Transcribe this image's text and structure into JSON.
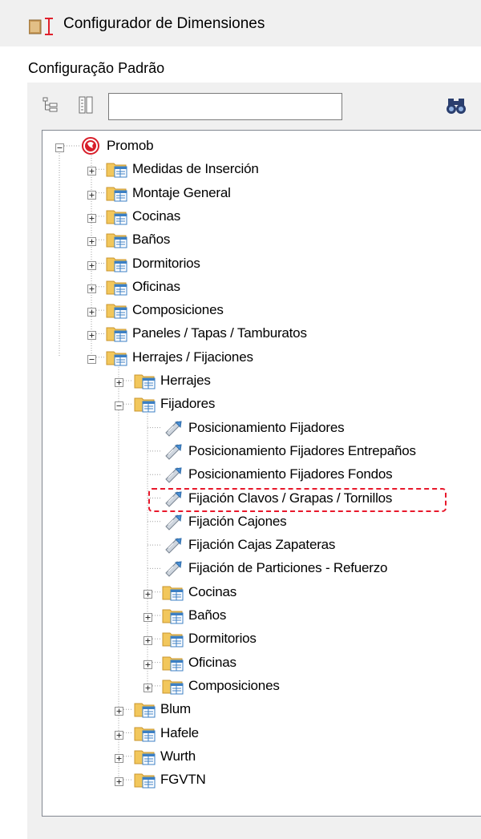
{
  "window": {
    "title": "Configurador de Dimensiones"
  },
  "config": {
    "label": "Configuração Padrão"
  },
  "toolbar": {
    "search_value": "",
    "search_placeholder": ""
  },
  "colors": {
    "highlight": "#e8182b",
    "folder": "#f2c75c",
    "tree_line": "#a0a0a0"
  },
  "tree": {
    "root": "Promob",
    "level1": [
      "Medidas de Inserción",
      "Montaje General",
      "Cocinas",
      "Baños",
      "Dormitorios",
      "Oficinas",
      "Composiciones",
      "Paneles / Tapas / Tamburatos",
      "Herrajes / Fijaciones"
    ],
    "herrajes_children": [
      "Herrajes",
      "Fijadores"
    ],
    "fijadores_items": [
      "Posicionamiento Fijadores",
      "Posicionamiento Fijadores Entrepaños",
      "Posicionamiento Fijadores Fondos",
      "Fijación Clavos / Grapas / Tornillos",
      "Fijación Cajones",
      "Fijación Cajas Zapateras",
      "Fijación de Particiones - Refuerzo"
    ],
    "fijadores_folders": [
      "Cocinas",
      "Baños",
      "Dormitorios",
      "Oficinas",
      "Composiciones"
    ],
    "herrajes_more": [
      "Blum",
      "Hafele",
      "Wurth",
      "FGVTN"
    ]
  }
}
